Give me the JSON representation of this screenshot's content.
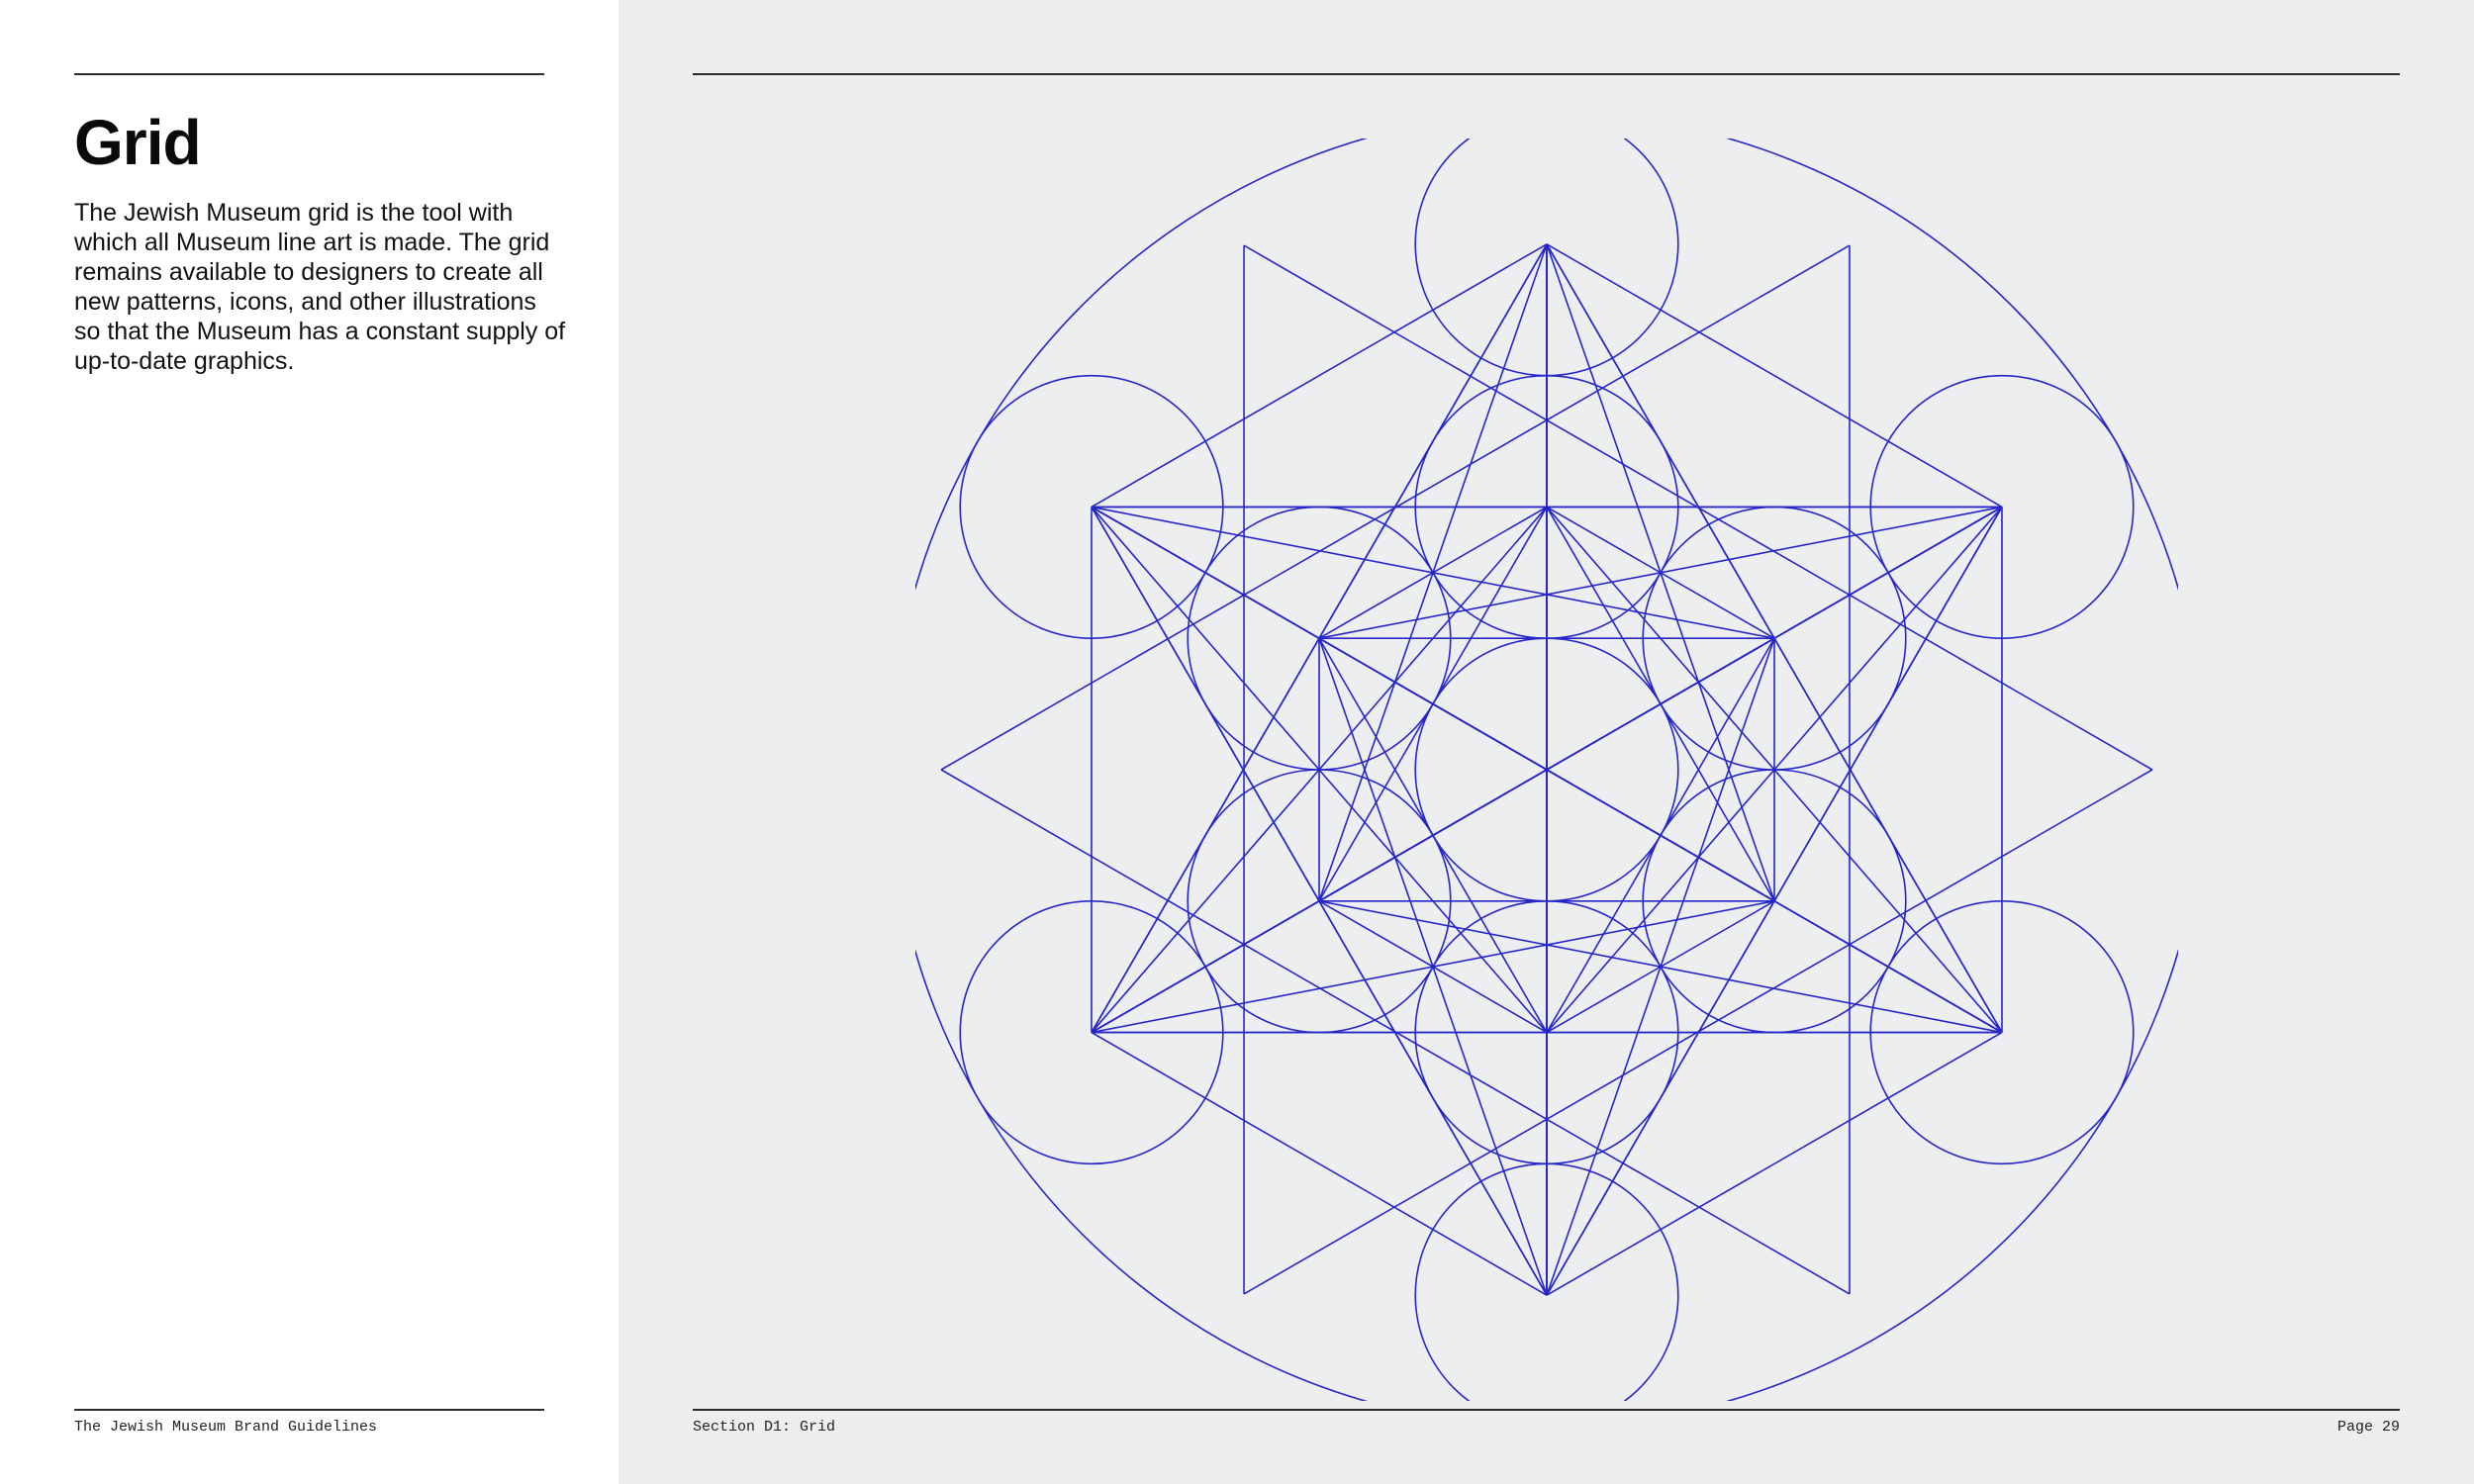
{
  "left": {
    "title": "Grid",
    "body": "The Jewish Museum grid is the tool with which all Museum line art is made. The grid remains available to designers to create all new patterns, icons, and other illustrations so that the Museum has a constant supply of up-to-date graphics.",
    "footer": "The Jewish Museum Brand Guidelines"
  },
  "right": {
    "section": "Section D1: Grid",
    "page": "Page 29"
  },
  "figure": {
    "name": "Jewish Museum grid",
    "line_color": "#2626c8"
  },
  "colors": {
    "left_background": "#ffffff",
    "right_background": "#edeef0",
    "rule": "#2a2a2a"
  }
}
